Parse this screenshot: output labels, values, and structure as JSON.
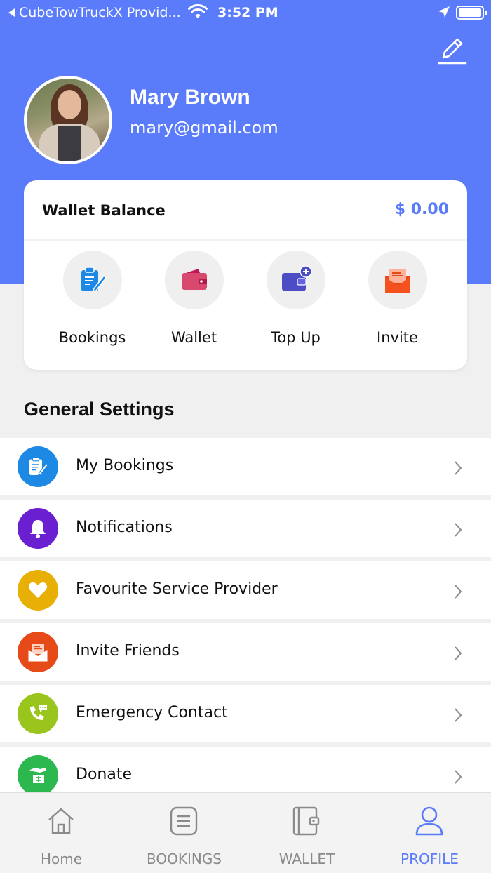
{
  "status_bar": {
    "back_app": "CubeTowTruckX Provid...",
    "time": "3:52 PM"
  },
  "profile": {
    "name": "Mary Brown",
    "email": "mary@gmail.com"
  },
  "wallet": {
    "label": "Wallet Balance",
    "amount": "$ 0.00",
    "actions": [
      {
        "label": "Bookings",
        "icon": "clipboard-edit-icon"
      },
      {
        "label": "Wallet",
        "icon": "wallet-icon"
      },
      {
        "label": "Top Up",
        "icon": "wallet-add-icon"
      },
      {
        "label": "Invite",
        "icon": "envelope-icon"
      }
    ]
  },
  "settings": {
    "title": "General Settings",
    "items": [
      {
        "label": "My Bookings",
        "icon": "clipboard-edit-icon",
        "color": "#1e88e5"
      },
      {
        "label": "Notifications",
        "icon": "bell-icon",
        "color": "#6a1fd1"
      },
      {
        "label": "Favourite Service Provider",
        "icon": "heart-icon",
        "color": "#e8b007"
      },
      {
        "label": "Invite Friends",
        "icon": "envelope-icon",
        "color": "#e64a19"
      },
      {
        "label": "Emergency Contact",
        "icon": "phone-chat-icon",
        "color": "#9ac51c"
      },
      {
        "label": "Donate",
        "icon": "donate-hand-icon",
        "color": "#2db84f"
      }
    ]
  },
  "tabbar": {
    "tabs": [
      {
        "label": "Home",
        "icon": "home-icon"
      },
      {
        "label": "BOOKINGS",
        "icon": "list-icon"
      },
      {
        "label": "WALLET",
        "icon": "wallet-icon"
      },
      {
        "label": "PROFILE",
        "icon": "user-icon"
      }
    ],
    "active": "PROFILE"
  },
  "colors": {
    "brand": "#5b7cfa",
    "background": "#f0f0f0"
  }
}
